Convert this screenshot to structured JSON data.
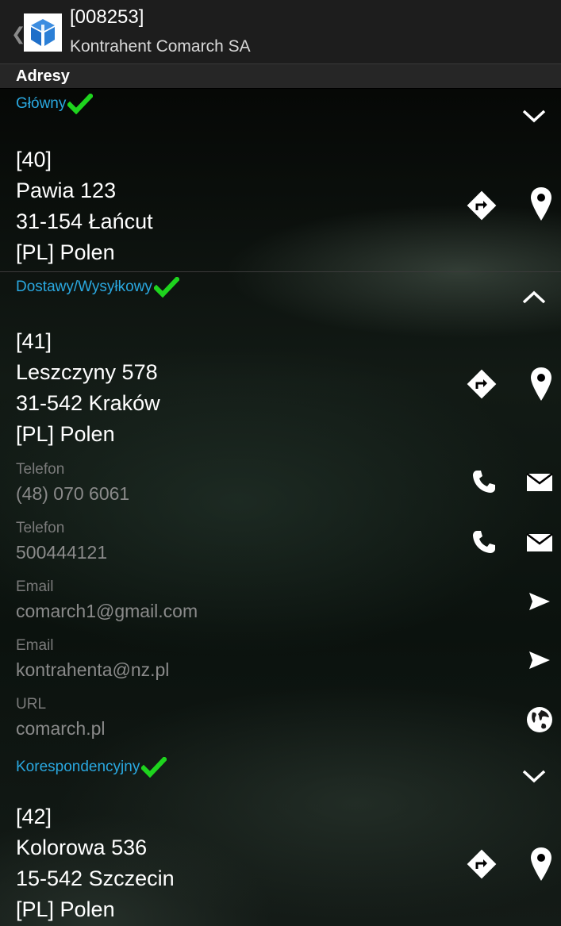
{
  "header": {
    "code": "[008253]",
    "name": "Kontrahent Comarch SA",
    "back_glyph": "❮"
  },
  "section": {
    "title": "Adresy"
  },
  "addresses": [
    {
      "type": "Główny",
      "expanded": false,
      "lines": [
        "[40]",
        "Pawia 123",
        "31-154 Łańcut",
        "[PL] Polen"
      ]
    },
    {
      "type": "Dostawy/Wysyłkowy",
      "expanded": true,
      "lines": [
        "[41]",
        "Leszczyny 578",
        "31-542 Kraków",
        "[PL] Polen"
      ],
      "contacts": [
        {
          "label": "Telefon",
          "value": "(48) 070 6061",
          "icons": [
            "phone-icon",
            "envelope-icon"
          ]
        },
        {
          "label": "Telefon",
          "value": "500444121",
          "icons": [
            "phone-icon",
            "envelope-icon"
          ]
        },
        {
          "label": "Email",
          "value": "comarch1@gmail.com",
          "icons": [
            "send-icon"
          ]
        },
        {
          "label": "Email",
          "value": "kontrahenta@nz.pl",
          "icons": [
            "send-icon"
          ]
        },
        {
          "label": "URL",
          "value": "comarch.pl",
          "icons": [
            "globe-icon"
          ]
        }
      ]
    },
    {
      "type": "Korespondencyjny",
      "expanded": false,
      "lines": [
        "[42]",
        "Kolorowa 536",
        "15-542 Szczecin",
        "[PL] Polen"
      ]
    }
  ],
  "colors": {
    "type_label": "#2aa8e0",
    "check": "#1ed41e",
    "header_bg": "#1d1d1d",
    "section_bar_bg": "#262626"
  }
}
